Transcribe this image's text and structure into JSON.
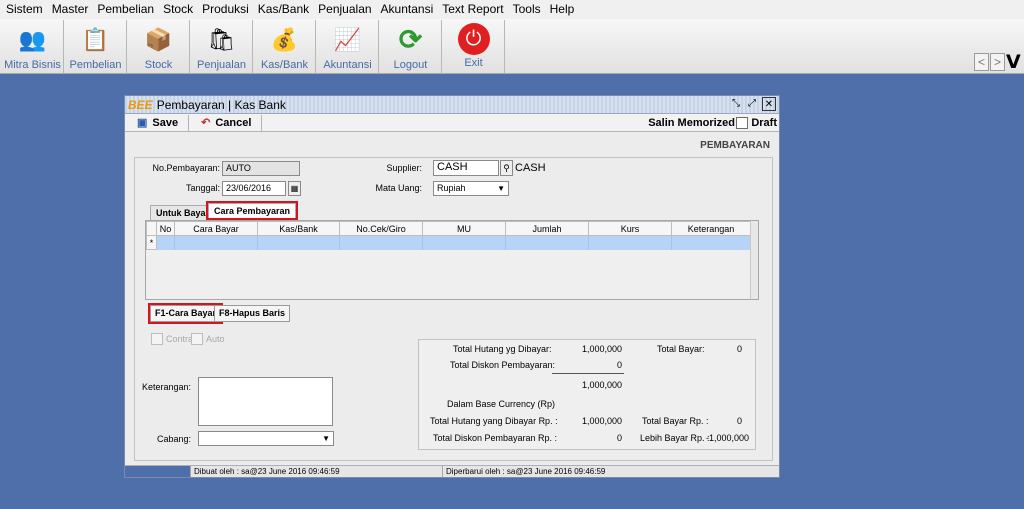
{
  "menu": [
    "Sistem",
    "Master",
    "Pembelian",
    "Stock",
    "Produksi",
    "Kas/Bank",
    "Penjualan",
    "Akuntansi",
    "Text Report",
    "Tools",
    "Help"
  ],
  "toolbar": [
    {
      "label": "Mitra Bisnis",
      "icon": "partners-icon",
      "glyph": "👥"
    },
    {
      "label": "Pembelian",
      "icon": "purchase-icon",
      "glyph": "📋"
    },
    {
      "label": "Stock",
      "icon": "stock-icon",
      "glyph": "📦"
    },
    {
      "label": "Penjualan",
      "icon": "sales-icon",
      "glyph": "🛍"
    },
    {
      "label": "Kas/Bank",
      "icon": "cash-bank-icon",
      "glyph": "💰"
    },
    {
      "label": "Akuntansi",
      "icon": "accounting-icon",
      "glyph": "📈"
    },
    {
      "label": "Logout",
      "icon": "logout-icon",
      "glyph": "⟳"
    },
    {
      "label": "Exit",
      "icon": "exit-icon",
      "glyph": "⏻"
    }
  ],
  "nav": {
    "prev": "<",
    "next": ">",
    "v": "V"
  },
  "window": {
    "logo": "BEE",
    "title": "Pembayaran | Kas Bank",
    "save_label": "Save",
    "cancel_label": "Cancel",
    "salin_label": "Salin Memorized",
    "draft_label": "Draft",
    "section_label": "PEMBAYARAN"
  },
  "form": {
    "no_label": "No.Pembayaran:",
    "no_value": "AUTO",
    "tanggal_label": "Tanggal:",
    "tanggal_value": "23/06/2016",
    "supplier_label": "Supplier:",
    "supplier_value": "CASH",
    "supplier_name": "CASH",
    "mata_uang_label": "Mata Uang:",
    "mata_uang_value": "Rupiah"
  },
  "tabs": [
    "Untuk Bayar",
    "Cara Pembayaran"
  ],
  "grid": {
    "columns": [
      "No",
      "Cara Bayar",
      "Kas/Bank",
      "No.Cek/Giro",
      "MU",
      "Jumlah",
      "Kurs",
      "Keterangan"
    ],
    "row_marker": "*"
  },
  "buttons": {
    "cara_bayar": "F1-Cara Bayar",
    "hapus_baris": "F8-Hapus Baris"
  },
  "options": {
    "contra": "Contra",
    "auto": "Auto"
  },
  "keterangan_label": "Keterangan:",
  "cabang_label": "Cabang:",
  "summary": {
    "total_hutang_label": "Total Hutang yg Dibayar:",
    "total_hutang_value": "1,000,000",
    "total_bayar_label": "Total Bayar:",
    "total_bayar_value": "0",
    "total_diskon_label": "Total Diskon Pembayaran:",
    "total_diskon_value": "0",
    "subtotal_value": "1,000,000",
    "base_currency_label": "Dalam Base Currency (Rp)",
    "hutang_rp_label": "Total Hutang yang Dibayar Rp. :",
    "hutang_rp_value": "1,000,000",
    "bayar_rp_label": "Total Bayar Rp. :",
    "bayar_rp_value": "0",
    "diskon_rp_label": "Total Diskon Pembayaran Rp. :",
    "diskon_rp_value": "0",
    "lebih_bayar_label": "Lebih Bayar Rp. :",
    "lebih_bayar_value": "-1,000,000"
  },
  "status": {
    "created": "Dibuat oleh : sa@23 June 2016  09:46:59",
    "updated": "Diperbarui oleh : sa@23 June 2016  09:46:59"
  },
  "colors": {
    "desktop": "#4f6faa",
    "highlight": "#d4141f",
    "grid_row": "#b7d3f7"
  }
}
